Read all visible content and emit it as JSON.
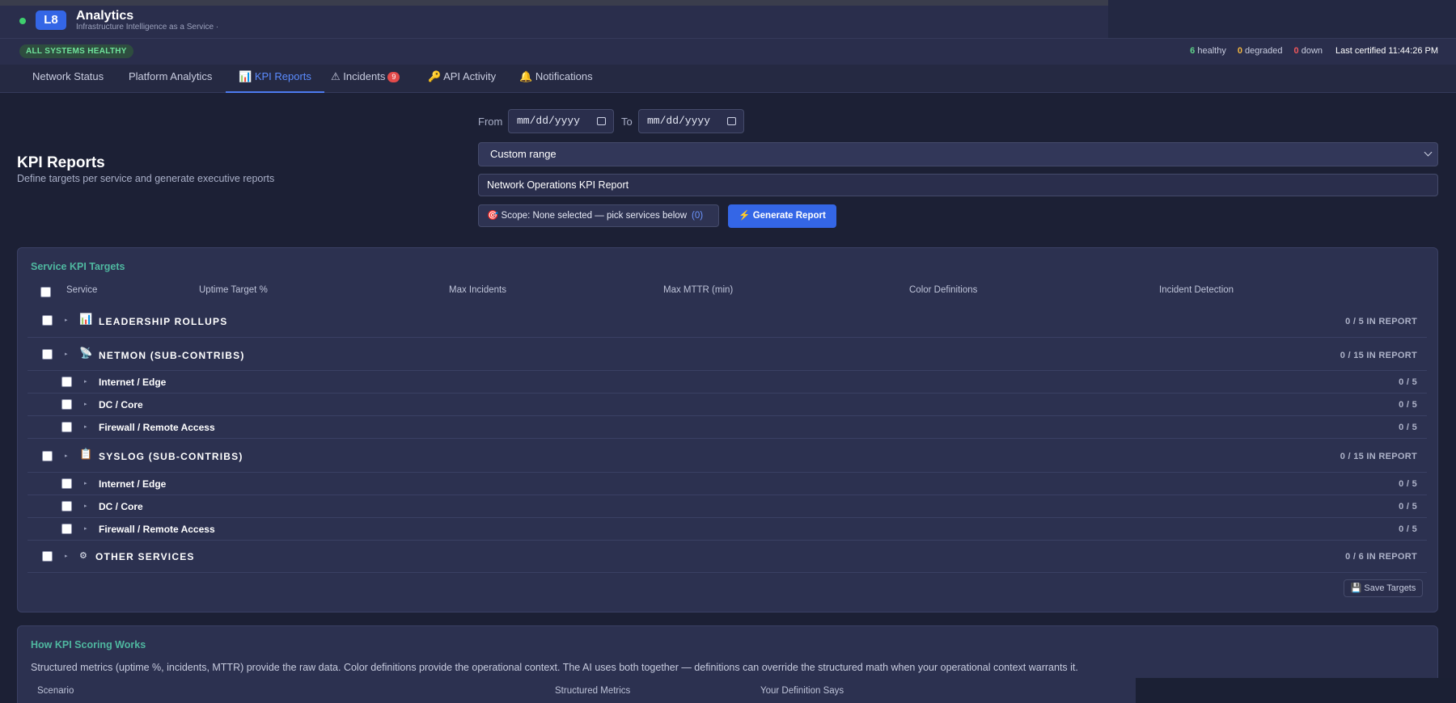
{
  "app": {
    "logo_text": "L8",
    "title": "Analytics",
    "subtitle": "Infrastructure Intelligence as a Service ·"
  },
  "status": {
    "badge": "ALL SYSTEMS HEALTHY",
    "healthy_count": "6",
    "healthy_label": "healthy",
    "degraded_count": "0",
    "degraded_label": "degraded",
    "down_count": "0",
    "down_label": "down",
    "last_certified": "Last certified 11:44:26 PM"
  },
  "tabs": [
    {
      "label": "Network Status"
    },
    {
      "label": "Platform Analytics"
    },
    {
      "icon": "📊",
      "label": "KPI Reports"
    },
    {
      "icon": "⚠",
      "label": "Incidents",
      "count": "9"
    },
    {
      "icon": "🔑",
      "label": "API Activity"
    },
    {
      "icon": "🔔",
      "label": "Notifications"
    }
  ],
  "page": {
    "title": "KPI Reports",
    "subtitle": "Define targets per service and generate executive reports"
  },
  "filters": {
    "from_label": "From",
    "to_label": "To",
    "from_placeholder": "mm/dd/yyyy",
    "to_placeholder": "mm/dd/yyyy",
    "range_value": "Custom range",
    "report_name": "Network Operations KPI Report",
    "scope_icon": "🎯",
    "scope_text": "Scope: None selected — pick services below",
    "scope_count": "(0)",
    "generate_label": "⚡ Generate Report"
  },
  "targets": {
    "title": "Service KPI Targets",
    "columns": [
      "Service",
      "Uptime Target %",
      "Max Incidents",
      "Max MTTR (min)",
      "Color Definitions",
      "Incident Detection"
    ],
    "groups": [
      {
        "icon": "📊",
        "name": "LEADERSHIP ROLLUPS",
        "count": "0 / 5 IN REPORT",
        "children": []
      },
      {
        "icon": "📡",
        "name": "NETMON (SUB-CONTRIBS)",
        "count": "0 / 15 IN REPORT",
        "children": [
          {
            "name": "Internet / Edge",
            "count": "0 / 5"
          },
          {
            "name": "DC / Core",
            "count": "0 / 5"
          },
          {
            "name": "Firewall / Remote Access",
            "count": "0 / 5"
          }
        ]
      },
      {
        "icon": "📋",
        "name": "SYSLOG (SUB-CONTRIBS)",
        "count": "0 / 15 IN REPORT",
        "children": [
          {
            "name": "Internet / Edge",
            "count": "0 / 5"
          },
          {
            "name": "DC / Core",
            "count": "0 / 5"
          },
          {
            "name": "Firewall / Remote Access",
            "count": "0 / 5"
          }
        ]
      },
      {
        "icon": "⚙",
        "name": "OTHER SERVICES",
        "count": "0 / 6 IN REPORT",
        "children": []
      }
    ],
    "save_label": "💾 Save Targets"
  },
  "scoring": {
    "title": "How KPI Scoring Works",
    "description": "Structured metrics (uptime %, incidents, MTTR) provide the raw data. Color definitions provide the operational context. The AI uses both together — definitions can override the structured math when your operational context warrants it.",
    "columns": [
      "Scenario",
      "Structured Metrics",
      "Your Definition Says"
    ]
  }
}
